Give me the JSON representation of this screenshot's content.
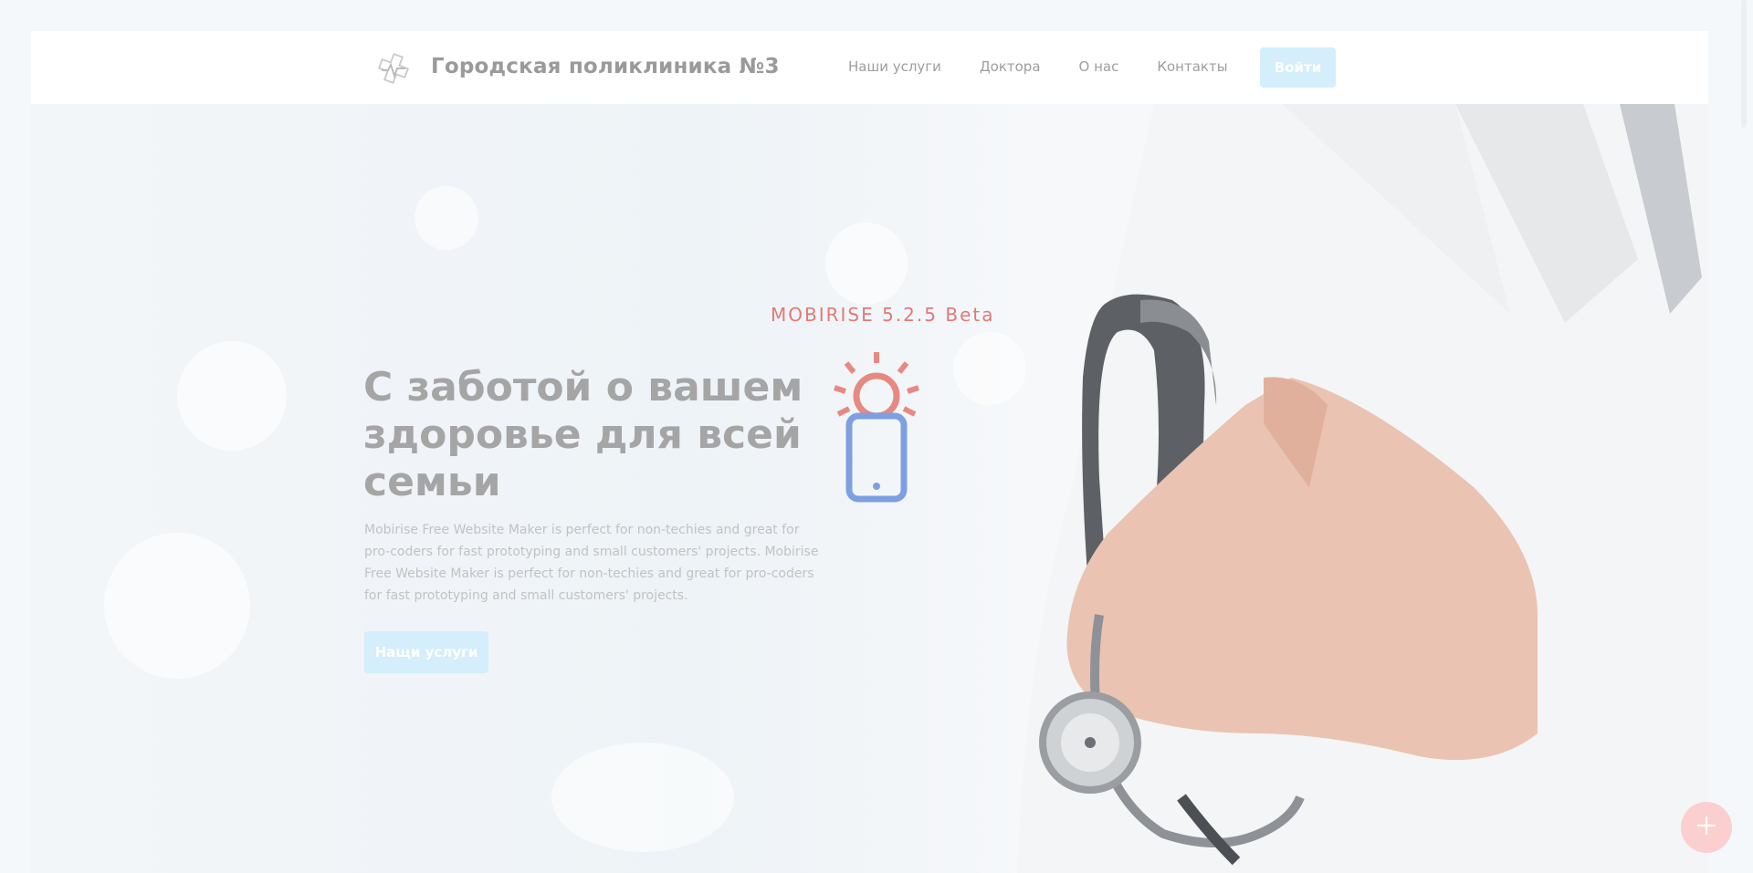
{
  "header": {
    "brand_name": "Городская поликлиника №3",
    "logo_icon": "medical-cross-logo-icon",
    "nav": [
      {
        "label": "Наши услуги"
      },
      {
        "label": "Доктора"
      },
      {
        "label": "О нас"
      },
      {
        "label": "Контакты"
      }
    ],
    "login_label": "Войти"
  },
  "hero": {
    "title": "С заботой о вашем здоровье для всей семьи",
    "text": "Mobirise Free Website Maker is perfect for non-techies and great for pro-coders for fast prototyping and small customers' projects. Mobirise Free Website Maker is perfect for non-techies and great for pro-coders for fast prototyping and small customers' projects.",
    "button_label": "Нащи услуги",
    "background_icon": "doctor-with-stethoscope-image"
  },
  "overlay": {
    "badge": "MOBIRISE  5.2.5 Beta",
    "icon": "phone-sun-icon"
  },
  "fab": {
    "icon": "plus-icon"
  },
  "colors": {
    "accent_button": "#d4eefb",
    "badge_red": "#e07a78",
    "phone_blue": "#7ea0e0",
    "fab": "#fbcfcf"
  }
}
